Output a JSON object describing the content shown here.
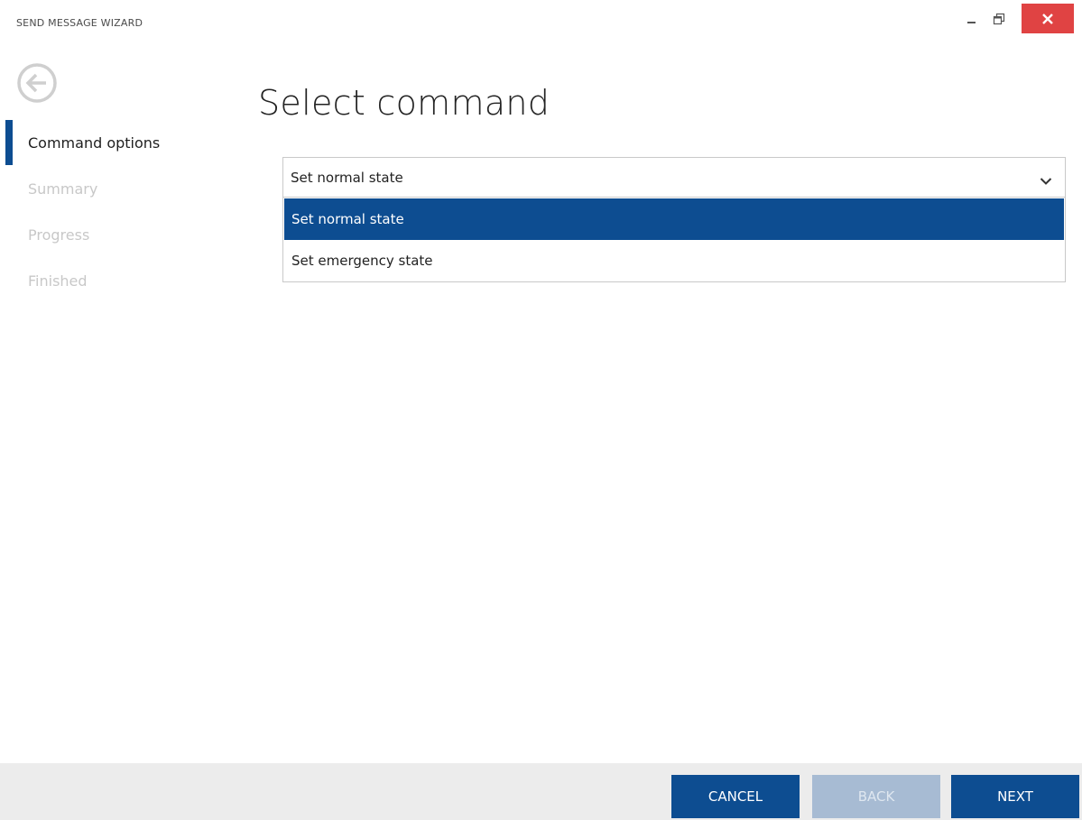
{
  "window": {
    "title": "SEND MESSAGE WIZARD",
    "controls": {
      "minimize_icon": "minimize-icon",
      "restore_icon": "restore-icon",
      "close_icon": "close-icon"
    }
  },
  "sidebar": {
    "back_icon": "back-arrow-circle-icon",
    "steps": [
      {
        "label": "Command options",
        "state": "active"
      },
      {
        "label": "Summary",
        "state": "inactive"
      },
      {
        "label": "Progress",
        "state": "inactive"
      },
      {
        "label": "Finished",
        "state": "inactive"
      }
    ]
  },
  "main": {
    "title": "Select command",
    "command_select": {
      "value": "Set normal state",
      "expanded": true,
      "chevron_icon": "chevron-down-icon",
      "options": [
        {
          "label": "Set normal state",
          "selected": true
        },
        {
          "label": "Set emergency state",
          "selected": false
        }
      ]
    }
  },
  "footer": {
    "cancel_label": "CANCEL",
    "back_label": "BACK",
    "back_enabled": false,
    "next_label": "NEXT"
  },
  "colors": {
    "accent": "#0d4d91",
    "disabled_button": "#a7bbd3",
    "close_button": "#e04343",
    "footer_bg": "#ececec",
    "inactive_step_text": "#c8c8c8"
  }
}
